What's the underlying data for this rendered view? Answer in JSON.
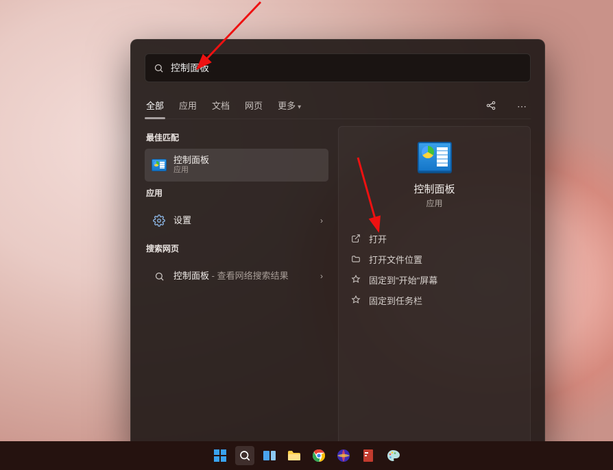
{
  "search": {
    "value": "控制面板"
  },
  "tabs": {
    "all": "全部",
    "apps": "应用",
    "docs": "文档",
    "web": "网页",
    "more": "更多"
  },
  "left": {
    "best_match_label": "最佳匹配",
    "best_match": {
      "title": "控制面板",
      "subtitle": "应用"
    },
    "apps_label": "应用",
    "settings": {
      "title": "设置"
    },
    "search_web_label": "搜索网页",
    "web_result": {
      "title": "控制面板",
      "suffix": " - 查看网络搜索结果"
    }
  },
  "detail": {
    "title": "控制面板",
    "subtitle": "应用",
    "actions": {
      "open": "打开",
      "open_location": "打开文件位置",
      "pin_start": "固定到\"开始\"屏幕",
      "pin_taskbar": "固定到任务栏"
    }
  }
}
